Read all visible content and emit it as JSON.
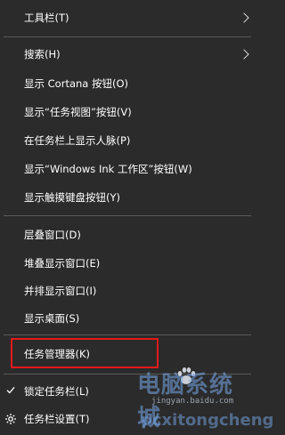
{
  "menu": {
    "items": [
      {
        "label": "工具栏(T)",
        "submenu": true
      },
      {
        "label": "搜索(H)",
        "submenu": true
      },
      {
        "label": "显示 Cortana 按钮(O)"
      },
      {
        "label": "显示“任务视图”按钮(V)"
      },
      {
        "label": "在任务栏上显示人脉(P)"
      },
      {
        "label": "显示“Windows Ink 工作区”按钮(W)"
      },
      {
        "label": "显示触摸键盘按钮(Y)"
      },
      {
        "label": "层叠窗口(D)"
      },
      {
        "label": "堆叠显示窗口(E)"
      },
      {
        "label": "并排显示窗口(I)"
      },
      {
        "label": "显示桌面(S)"
      },
      {
        "label": "任务管理器(K)",
        "highlighted": true
      },
      {
        "label": "锁定任务栏(L)",
        "checked": true,
        "icon": "checkmark-icon"
      },
      {
        "label": "任务栏设置(T)",
        "icon": "gear-icon"
      }
    ]
  },
  "watermark": {
    "text": "电脑系统城",
    "url": "jingyan.baidu.com",
    "url2": "pcxitongcheng"
  },
  "colors": {
    "background": "#2b2b2b",
    "text": "#ffffff",
    "separator": "#5a5a5a",
    "highlight_border": "#e6191b"
  }
}
